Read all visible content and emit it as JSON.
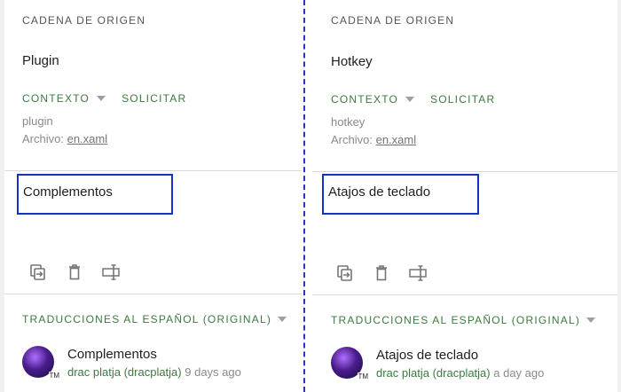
{
  "colors": {
    "accent_green": "#3c7a3f",
    "focus_blue": "#1433c4",
    "divider_dashed": "#1a3cc8"
  },
  "panels": [
    {
      "source_label": "CADENA DE ORIGEN",
      "source_text": "Plugin",
      "context_label": "CONTEXTO",
      "request_label": "SOLICITAR",
      "key": "plugin",
      "file_prefix": "Archivo:",
      "file_name": "en.xaml",
      "editor_value": "Complementos",
      "toolbar_icons": [
        "copy-source-icon",
        "delete-icon",
        "text-cursor-icon"
      ],
      "translations_label": "TRADUCCIONES AL ESPAÑOL (ORIGINAL)",
      "suggestion": {
        "text": "Complementos",
        "author": "drac platja (dracplatja)",
        "time": "9 days ago",
        "avatar_badge": "TM"
      }
    },
    {
      "source_label": "CADENA DE ORIGEN",
      "source_text": "Hotkey",
      "context_label": "CONTEXTO",
      "request_label": "SOLICITAR",
      "key": "hotkey",
      "file_prefix": "Archivo:",
      "file_name": "en.xaml",
      "editor_value": "Atajos de teclado",
      "toolbar_icons": [
        "copy-source-icon",
        "delete-icon",
        "text-cursor-icon"
      ],
      "translations_label": "TRADUCCIONES AL ESPAÑOL (ORIGINAL)",
      "suggestion": {
        "text": "Atajos de teclado",
        "author": "drac platja (dracplatja)",
        "time": "a day ago",
        "avatar_badge": "TM"
      }
    }
  ]
}
